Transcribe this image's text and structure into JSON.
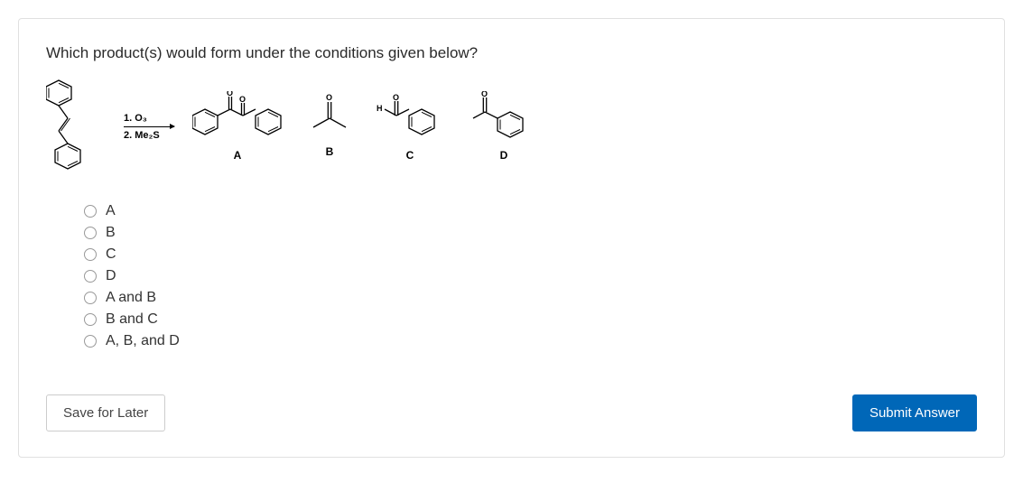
{
  "question": "Which product(s) would form under the conditions given below?",
  "reaction": {
    "step1": "1. O₃",
    "step2": "2. Me₂S"
  },
  "structure_labels": {
    "A": "A",
    "B": "B",
    "C": "C",
    "D": "D"
  },
  "hydrogen_label": "H",
  "options": [
    {
      "label": "A"
    },
    {
      "label": "B"
    },
    {
      "label": "C"
    },
    {
      "label": "D"
    },
    {
      "label": "A and B"
    },
    {
      "label": "B and C"
    },
    {
      "label": "A, B, and D"
    }
  ],
  "buttons": {
    "save": "Save for Later",
    "submit": "Submit Answer"
  }
}
